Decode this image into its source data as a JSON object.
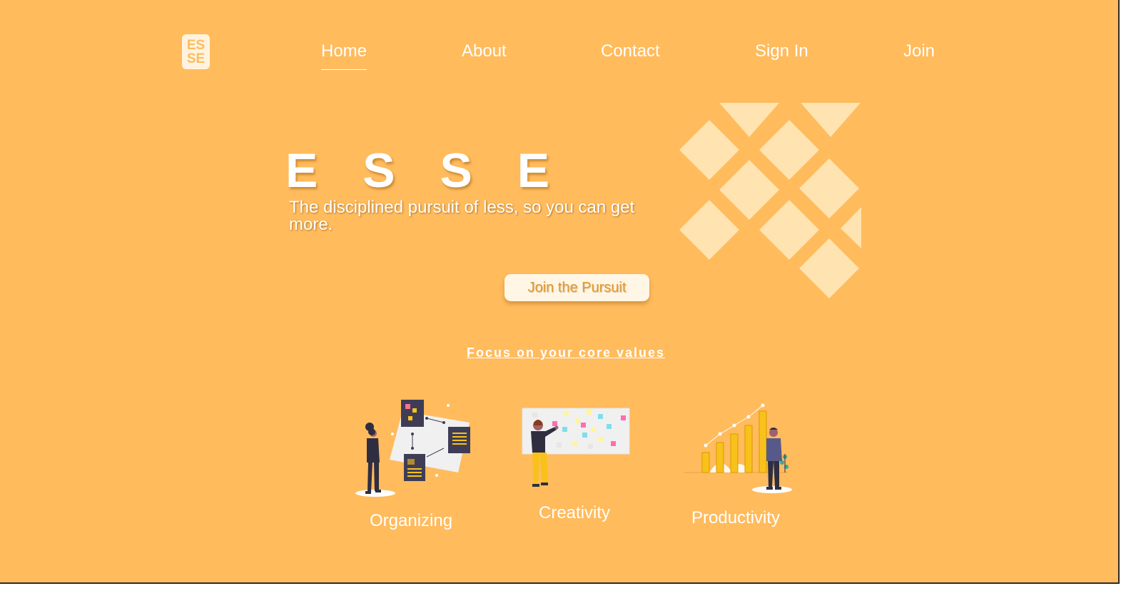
{
  "logo": {
    "line1": "ES",
    "line2": "SE"
  },
  "nav": {
    "items": [
      {
        "label": "Home",
        "active": true
      },
      {
        "label": "About",
        "active": false
      },
      {
        "label": "Contact",
        "active": false
      },
      {
        "label": "Sign In",
        "active": false
      },
      {
        "label": "Join",
        "active": false
      }
    ]
  },
  "hero": {
    "title": "E S S E",
    "subtitle": "The disciplined pursuit of less, so you can get more.",
    "cta_label": "Join the Pursuit"
  },
  "values": {
    "heading": "Focus on your core values",
    "items": [
      {
        "label": "Organizing",
        "icon": "organizing-illustration"
      },
      {
        "label": "Creativity",
        "icon": "creativity-illustration"
      },
      {
        "label": "Productivity",
        "icon": "productivity-illustration"
      }
    ]
  },
  "colors": {
    "background": "#ffbb5c",
    "accent": "#ffe3b0",
    "text": "#ffffff",
    "cta_text": "#e39a2e"
  }
}
